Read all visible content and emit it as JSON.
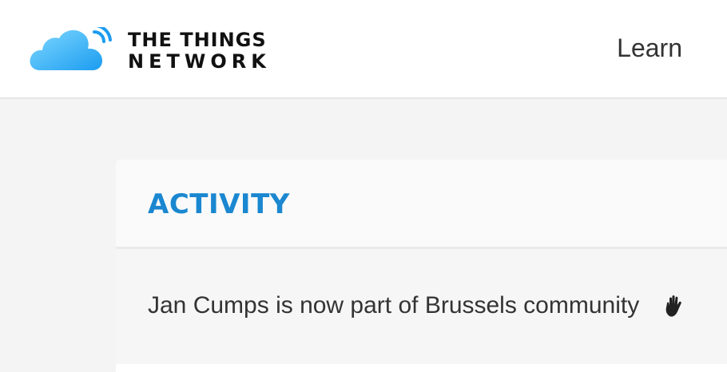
{
  "header": {
    "logo_line1": "THE THINGS",
    "logo_line2": "NETWORK",
    "logo_icon": "cloud-wifi-logo",
    "nav_learn": "Learn"
  },
  "activity": {
    "title": "ACTIVITY",
    "items": [
      {
        "text": "Jan Cumps is now part of Brussels community",
        "icon": "waving-hand-icon"
      }
    ]
  },
  "colors": {
    "accent": "#1a87d0",
    "logo_cloud_light": "#6fd0ff",
    "logo_cloud_dark": "#1b9cf0",
    "text": "#333333",
    "background": "#f4f4f4"
  }
}
